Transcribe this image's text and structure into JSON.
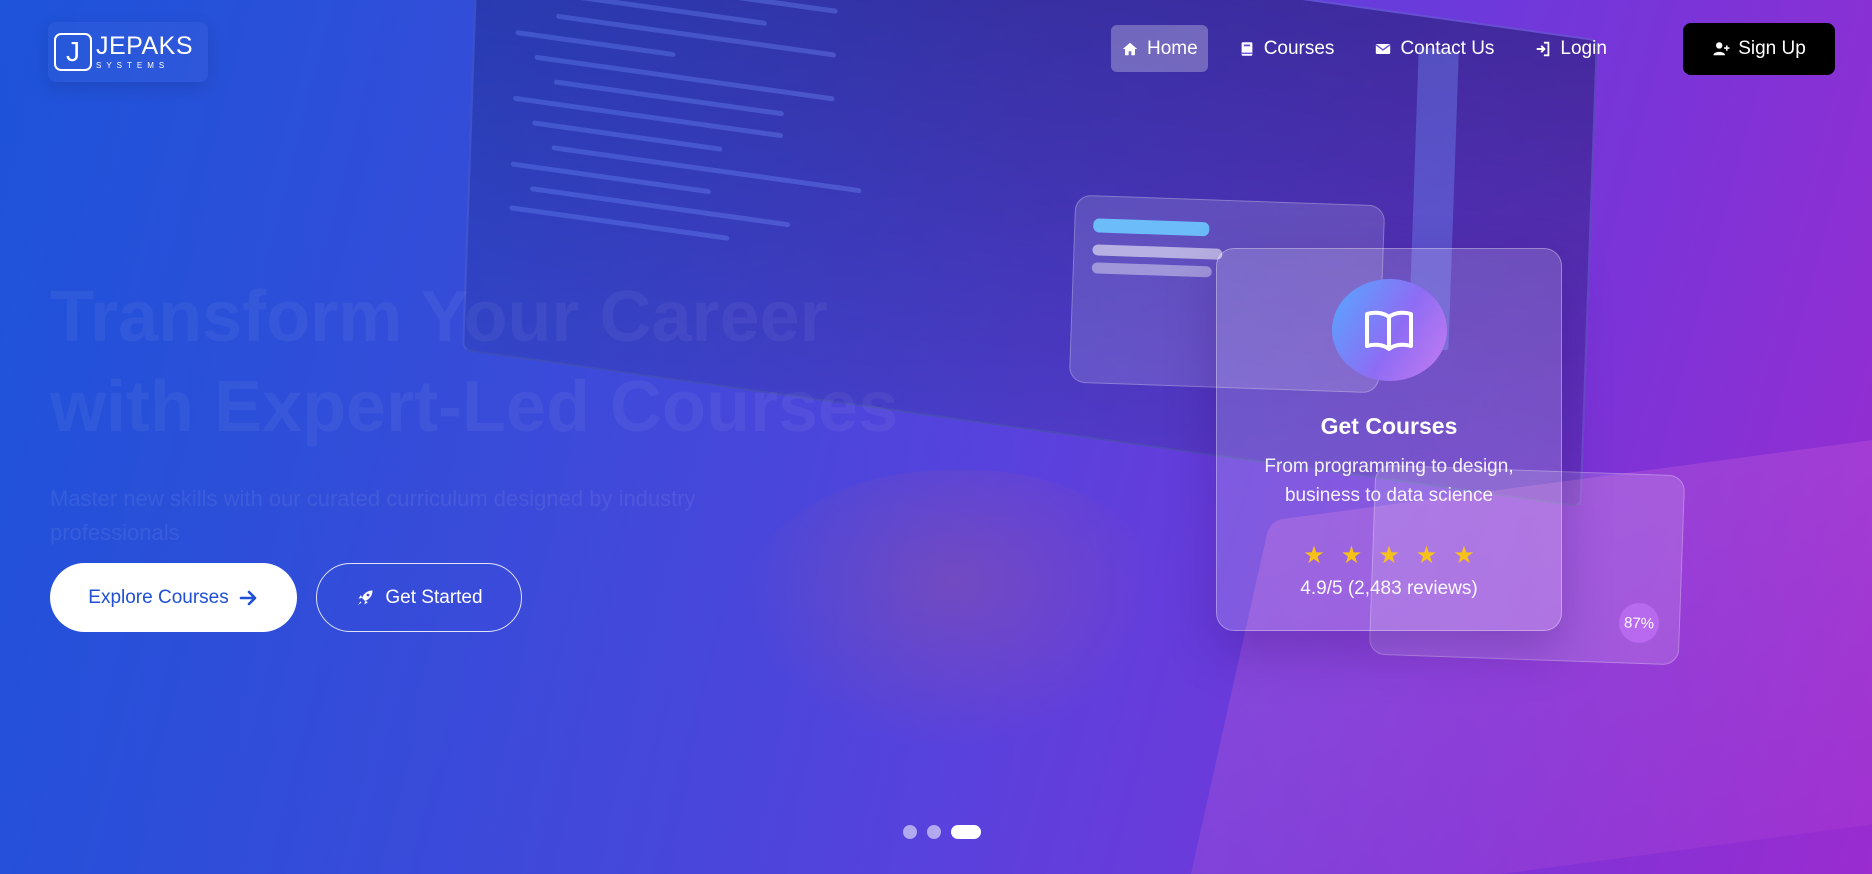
{
  "brand": {
    "logo_letter": "J",
    "name": "JEPAKS",
    "tagline": "SYSTEMS"
  },
  "nav": {
    "items": [
      {
        "label": "Home",
        "icon": "home-icon",
        "active": true
      },
      {
        "label": "Courses",
        "icon": "book-icon",
        "active": false
      },
      {
        "label": "Contact Us",
        "icon": "envelope-icon",
        "active": false
      },
      {
        "label": "Login",
        "icon": "login-icon",
        "active": false
      }
    ],
    "signup_label": "Sign Up"
  },
  "hero": {
    "title_line1": "Transform Your Career",
    "title_line2": "with Expert-Led Courses",
    "subtitle": "Master new skills with our curated curriculum designed by industry professionals",
    "explore_label": "Explore Courses",
    "start_label": "Get Started"
  },
  "feature_card": {
    "icon": "open-book-icon",
    "title": "Get Courses",
    "description": "From programming to design, business to data science",
    "stars": 5,
    "rating_text": "4.9/5 (2,483 reviews)"
  },
  "progress_card": {
    "percent_label": "87%"
  },
  "carousel": {
    "slides": 3,
    "active_index": 2
  },
  "colors": {
    "accent": "#1f4fd6",
    "star": "#f6c21a",
    "signup_bg": "#000000"
  }
}
